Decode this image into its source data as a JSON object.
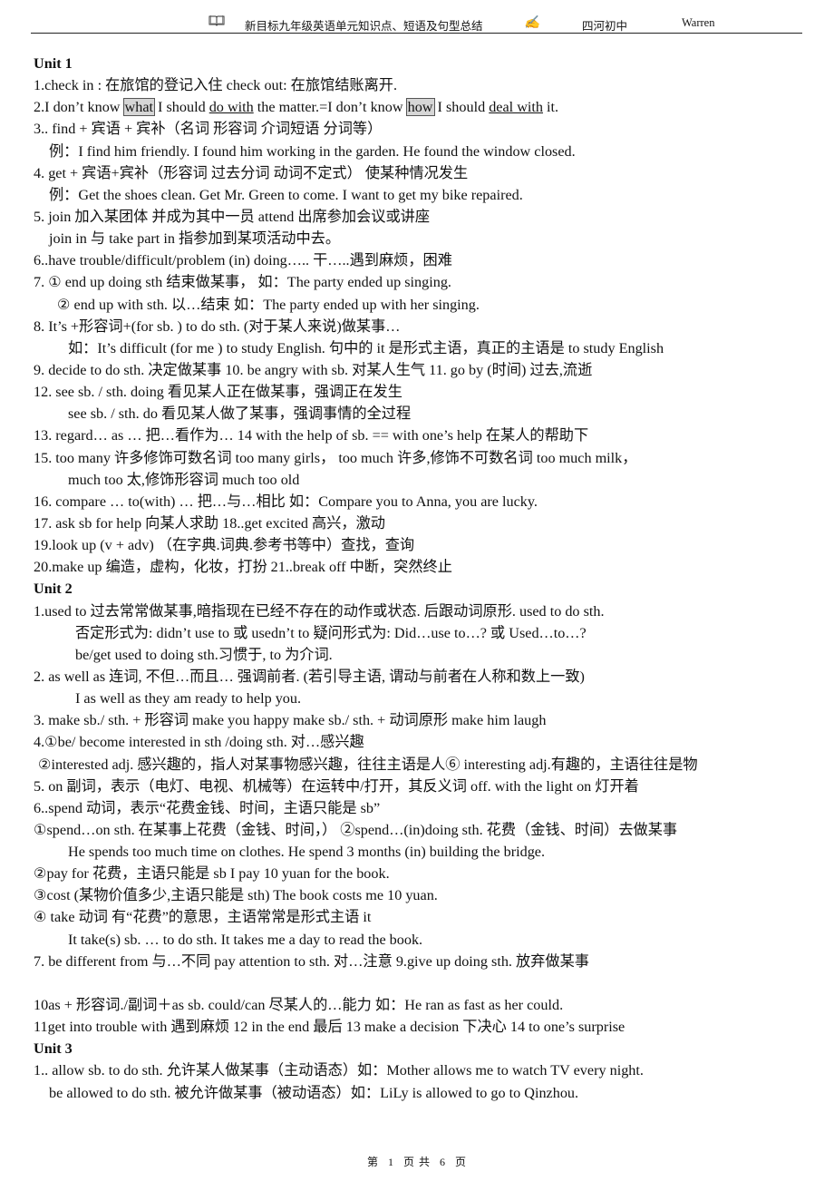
{
  "header": {
    "book_icon": "open-book-icon",
    "title": "新目标九年级英语单元知识点、短语及句型总结",
    "pen_icon": "writing-pen-icon",
    "school": "四河初中",
    "author": "Warren"
  },
  "units": [
    {
      "title": "Unit 1",
      "lines": [
        {
          "indent": 0,
          "parts": [
            {
              "t": "1.check in :  在旅馆的登记入住          check out:  在旅馆结账离开."
            }
          ]
        },
        {
          "indent": 0,
          "parts": [
            {
              "t": "2.I don’t know "
            },
            {
              "t": "what",
              "style": "hl"
            },
            {
              "t": " I should "
            },
            {
              "t": "do with",
              "style": "ul"
            },
            {
              "t": " the matter.=I don’t know "
            },
            {
              "t": "how",
              "style": "hl"
            },
            {
              "t": " I should "
            },
            {
              "t": "deal with",
              "style": "ul"
            },
            {
              "t": " it."
            }
          ]
        },
        {
          "indent": 0,
          "parts": [
            {
              "t": "3.. find +  宾语  +  宾补（名词  形容词  介词短语  分词等）"
            }
          ]
        },
        {
          "indent": 1,
          "parts": [
            {
              "t": "例：I find him friendly. I found him working in the garden. He found the window closed."
            }
          ]
        },
        {
          "indent": 0,
          "parts": [
            {
              "t": "4. get +  宾语+宾补（形容词  过去分词  动词不定式）   使某种情况发生"
            }
          ]
        },
        {
          "indent": 1,
          "parts": [
            {
              "t": "例：Get the shoes clean.      Get Mr. Green to come. I want to get my bike repaired."
            }
          ]
        },
        {
          "indent": 0,
          "parts": [
            {
              "t": "5. join  加入某团体  并成为其中一员       attend  出席参加会议或讲座"
            }
          ]
        },
        {
          "indent": 1,
          "parts": [
            {
              "t": "join in 与 take part in 指参加到某项活动中去。"
            }
          ]
        },
        {
          "indent": 0,
          "parts": [
            {
              "t": "6..have trouble/difficult/problem (in) doing…..  干…..遇到麻烦，困难"
            }
          ]
        },
        {
          "indent": 0,
          "parts": [
            {
              "t": "7.  ①  end up doing sth        结束做某事，     如：The party ended up singing."
            }
          ]
        },
        {
          "indent": 2,
          "parts": [
            {
              "t": "②  end up with sth.        以…结束  如：The party ended up with her singing."
            }
          ]
        },
        {
          "indent": 0,
          "parts": [
            {
              "t": "8. It’s +形容词+(for sb. ) to do sth. (对于某人来说)做某事…"
            }
          ]
        },
        {
          "indent": 3,
          "parts": [
            {
              "t": "如：It’s difficult (for me ) to study English.  句中的 it  是形式主语，真正的主语是 to study English"
            }
          ]
        },
        {
          "indent": 0,
          "parts": [
            {
              "t": "9. decide to do sth.  决定做某事  10. be angry with sb.  对某人生气     11. go by (时间)     过去,流逝"
            }
          ]
        },
        {
          "indent": 0,
          "parts": [
            {
              "t": "12. see sb. / sth. doing  看见某人正在做某事，强调正在发生"
            }
          ]
        },
        {
          "indent": 3,
          "parts": [
            {
              "t": "see sb. / sth. do 看见某人做了某事，强调事情的全过程"
            }
          ]
        },
        {
          "indent": 0,
          "parts": [
            {
              "t": "13. regard… as …  把…看作为…      14 with the help of sb. == with one’s help  在某人的帮助下"
            }
          ]
        },
        {
          "indent": 0,
          "parts": [
            {
              "t": "15. too many 许多修饰可数名词 too many girls，        too much 许多,修饰不可数名词 too much milk，"
            }
          ]
        },
        {
          "indent": 3,
          "parts": [
            {
              "t": "much too 太,修饰形容词  much too old"
            }
          ]
        },
        {
          "indent": 0,
          "parts": [
            {
              "t": "16. compare … to(with) …     把…与…相比     如：Compare you to Anna, you are lucky."
            }
          ]
        },
        {
          "indent": 0,
          "parts": [
            {
              "t": "17. ask sb for help  向某人求助              18..get excited  高兴，激动"
            }
          ]
        },
        {
          "indent": 0,
          "parts": [
            {
              "t": "19.look up (v + adv)  （在字典.词典.参考书等中）查找，查询"
            }
          ]
        },
        {
          "indent": 0,
          "parts": [
            {
              "t": "20.make up  编造，虚构，化妆，打扮      21..break off  中断，突然终止"
            }
          ]
        }
      ]
    },
    {
      "title": "Unit 2",
      "lines": [
        {
          "indent": 0,
          "parts": [
            {
              "t": "1.used to     过去常常做某事,暗指现在已经不存在的动作或状态.  后跟动词原形. used to do sth."
            }
          ]
        },
        {
          "indent": 4,
          "parts": [
            {
              "t": "否定形式为: didn’t use to  或  usedn’t to       疑问形式为: Did…use to…?  或  Used…to…?"
            }
          ]
        },
        {
          "indent": 4,
          "parts": [
            {
              "t": "  be/get used to doing sth.习惯于, to  为介词."
            }
          ]
        },
        {
          "indent": 0,
          "parts": [
            {
              "t": "2. as well as    连词, 不但…而且…     强调前者. (若引导主语, 谓动与前者在人称和数上一致)"
            }
          ]
        },
        {
          "indent": 4,
          "parts": [
            {
              "t": "  I as well as they am ready to help you."
            }
          ]
        },
        {
          "indent": 0,
          "parts": [
            {
              "t": "3. make sb./ sth. +  形容词      make you happy    make sb./ sth. +  动词原形    make him laugh"
            }
          ]
        },
        {
          "indent": 0,
          "parts": [
            {
              "t": "4.①be/ become interested in sth /doing sth.  对…感兴趣"
            }
          ]
        },
        {
          "indent": 5,
          "parts": [
            {
              "t": "②interested adj.  感兴趣的，指人对某事物感兴趣，往往主语是人⑥  interesting adj.有趣的，主语往往是物"
            }
          ]
        },
        {
          "indent": 0,
          "parts": [
            {
              "t": "5. on  副词，表示（电灯、电视、机械等）在运转中/打开，其反义词 off.     with the light on  灯开着"
            }
          ]
        },
        {
          "indent": 0,
          "parts": [
            {
              "t": "6..spend  动词，表示“花费金钱、时间，主语只能是 sb”"
            }
          ]
        },
        {
          "indent": 0,
          "parts": [
            {
              "t": "①spend…on sth.  在某事上花费（金钱、时间，）  ②spend…(in)doing sth.  花费（金钱、时间）去做某事"
            }
          ]
        },
        {
          "indent": 3,
          "parts": [
            {
              "t": "He spends too much time on clothes.    He spend 3 months (in) building the bridge."
            }
          ]
        },
        {
          "indent": 0,
          "parts": [
            {
              "t": "②pay for  花费，主语只能是 sb      I pay 10 yuan for the book."
            }
          ]
        },
        {
          "indent": 0,
          "parts": [
            {
              "t": "③cost (某物价值多少,主语只能是 sth)    The book costs me 10 yuan."
            }
          ]
        },
        {
          "indent": 0,
          "parts": [
            {
              "t": "④  take 动词  有“花费”的意思，主语常常是形式主语 it"
            }
          ]
        },
        {
          "indent": 3,
          "parts": [
            {
              "t": "It take(s) sb. … to do sth.    It takes me a day to read the book."
            }
          ]
        },
        {
          "indent": 0,
          "parts": [
            {
              "t": "7. be different from  与…不同    pay attention to sth.  对…注意    9.give up doing sth.  放弃做某事"
            }
          ]
        },
        {
          "indent": -1,
          "parts": []
        },
        {
          "indent": 0,
          "parts": [
            {
              "t": "10as +  形容词./副词＋as sb. could/can  尽某人的…能力     如：He ran as fast as her could."
            }
          ]
        },
        {
          "indent": 0,
          "parts": [
            {
              "t": "11get into trouble with  遇到麻烦     12 in the end  最后 13 make a decision 下决心     14 to one’s surprise"
            }
          ]
        }
      ]
    },
    {
      "title": "Unit 3",
      "lines": [
        {
          "indent": 0,
          "parts": [
            {
              "t": "1.. allow sb. to do sth.  允许某人做某事（主动语态）如：Mother allows me to watch TV every night."
            }
          ]
        },
        {
          "indent": 1,
          "parts": [
            {
              "t": "be allowed to do sth.  被允许做某事（被动语态）如：LiLy is allowed to go to Qinzhou."
            }
          ]
        }
      ]
    }
  ],
  "footer": {
    "label_prefix": "第",
    "current_page": "1",
    "label_mid": "页  共",
    "total_pages": "6",
    "label_suffix": "页"
  }
}
